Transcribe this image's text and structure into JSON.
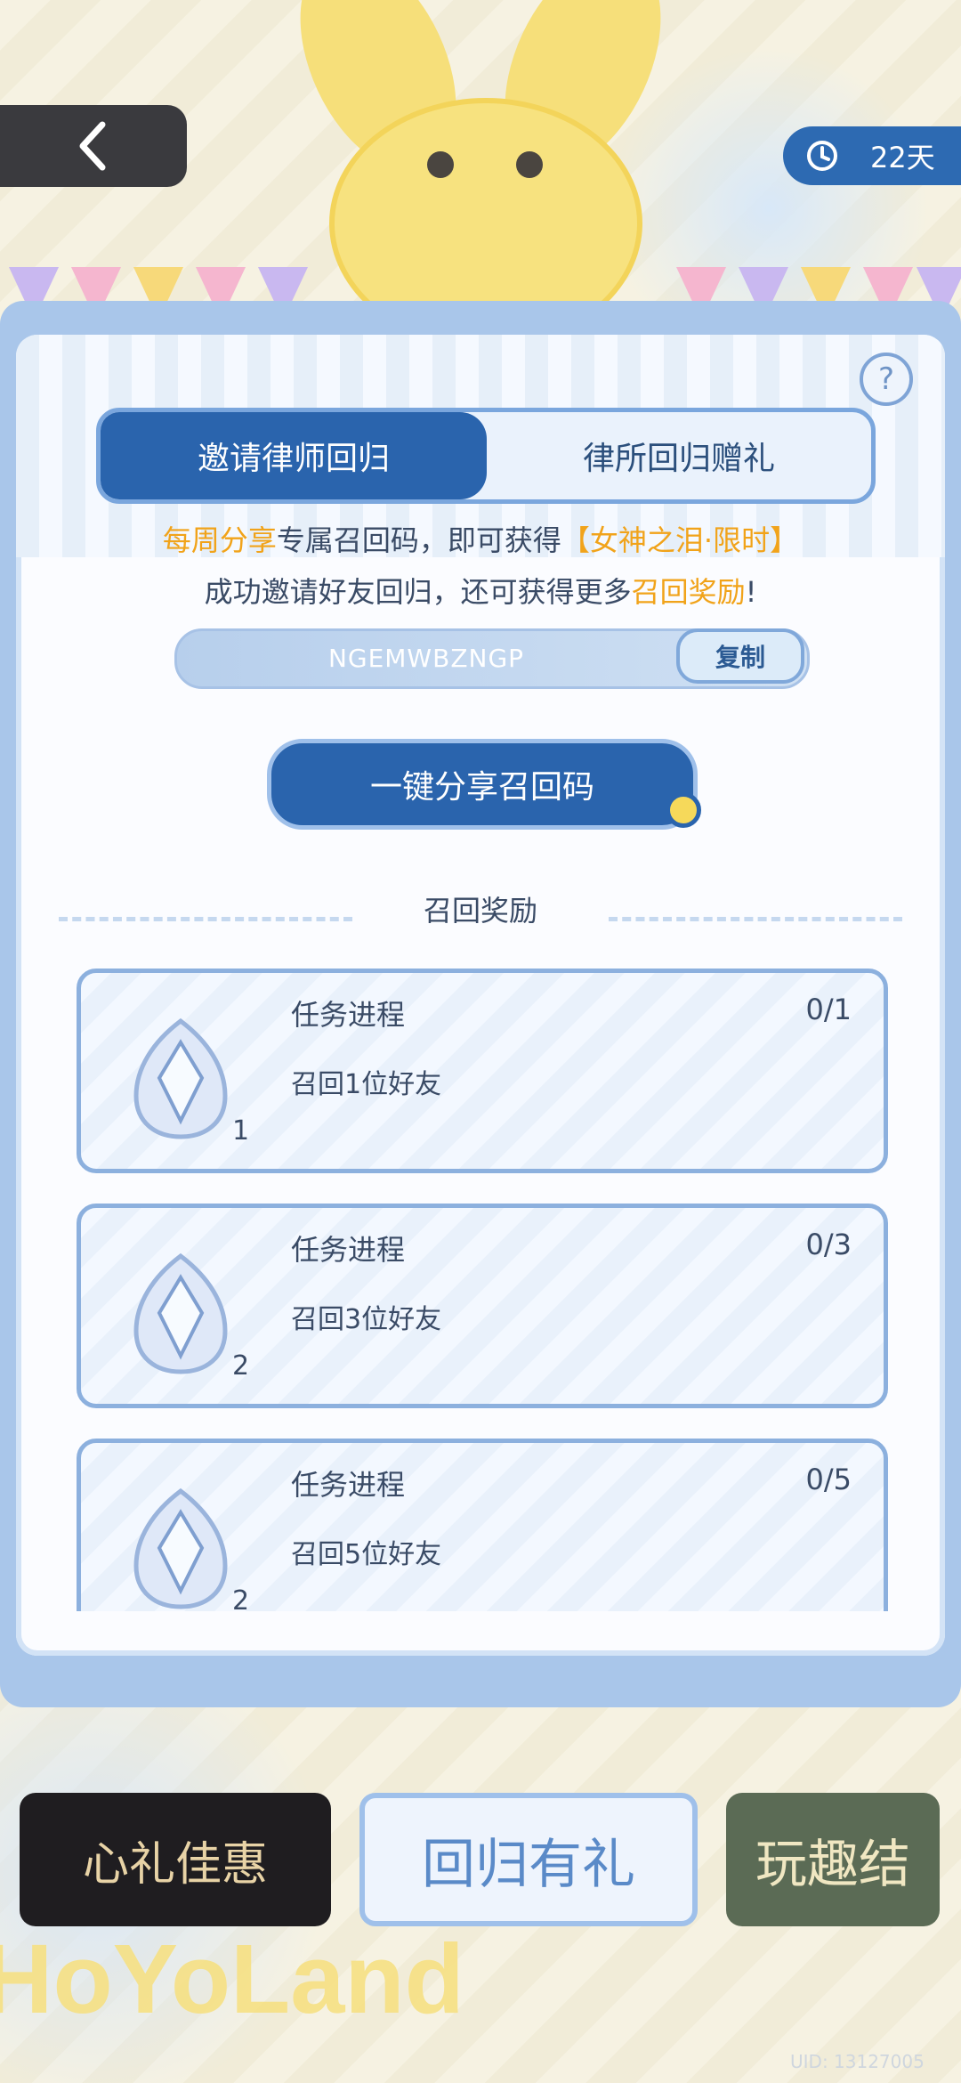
{
  "header": {
    "days_left": "22天"
  },
  "tabs": [
    {
      "label": "邀请律师回归",
      "active": true
    },
    {
      "label": "律所回归赠礼",
      "active": false
    }
  ],
  "invite": {
    "line1_part1": "每周分享",
    "line1_part2": "专属召回码，即可获得",
    "line1_part3": "【女神之泪·限时】",
    "line2_part1": "成功邀请好友回归，还可获得更多",
    "line2_part2": "召回奖励",
    "line2_part3": "!",
    "code": "NGEMWBZNGP",
    "copy_label": "复制",
    "share_label": "一键分享召回码"
  },
  "rewards": {
    "section_title": "召回奖励",
    "items": [
      {
        "title": "任务进程",
        "progress": "0/1",
        "desc": "召回1位好友",
        "count": "1"
      },
      {
        "title": "任务进程",
        "progress": "0/3",
        "desc": "召回3位好友",
        "count": "2"
      },
      {
        "title": "任务进程",
        "progress": "0/5",
        "desc": "召回5位好友",
        "count": "2"
      }
    ]
  },
  "banners": [
    {
      "label": "心礼佳惠"
    },
    {
      "label": "回归有礼"
    },
    {
      "label": "玩趣结"
    }
  ],
  "footer": {
    "uid": "UID: 13127005",
    "brand": "HoYoLand"
  },
  "colors": {
    "accent": "#2a64ad",
    "highlight": "#f1a31a",
    "text": "#3a4b66"
  }
}
